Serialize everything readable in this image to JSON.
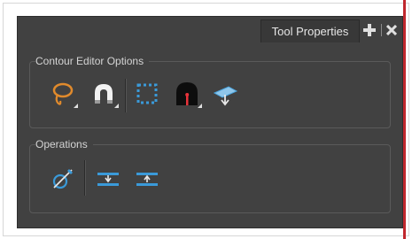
{
  "panel": {
    "tab_title": "Tool Properties",
    "add_icon": "plus-icon",
    "close_icon": "close-icon"
  },
  "contour_group": {
    "title": "Contour Editor Options",
    "tools": [
      {
        "name": "lasso",
        "icon": "lasso-icon"
      },
      {
        "name": "snap",
        "icon": "magnet-icon"
      },
      {
        "name": "marquee",
        "icon": "marquee-select-icon"
      },
      {
        "name": "contour-editor",
        "icon": "arch-icon"
      },
      {
        "name": "show-all-handles",
        "icon": "handles-icon"
      }
    ]
  },
  "operations_group": {
    "title": "Operations",
    "tools": [
      {
        "name": "pencil-to-brush",
        "icon": "pencil-brush-icon"
      },
      {
        "name": "flatten",
        "icon": "flatten-icon"
      },
      {
        "name": "distribute",
        "icon": "distribute-icon"
      }
    ]
  },
  "colors": {
    "panel_bg": "#414141",
    "accent_orange": "#e08a2c",
    "accent_blue": "#3a9ad9",
    "accent_red": "#e8333a"
  }
}
